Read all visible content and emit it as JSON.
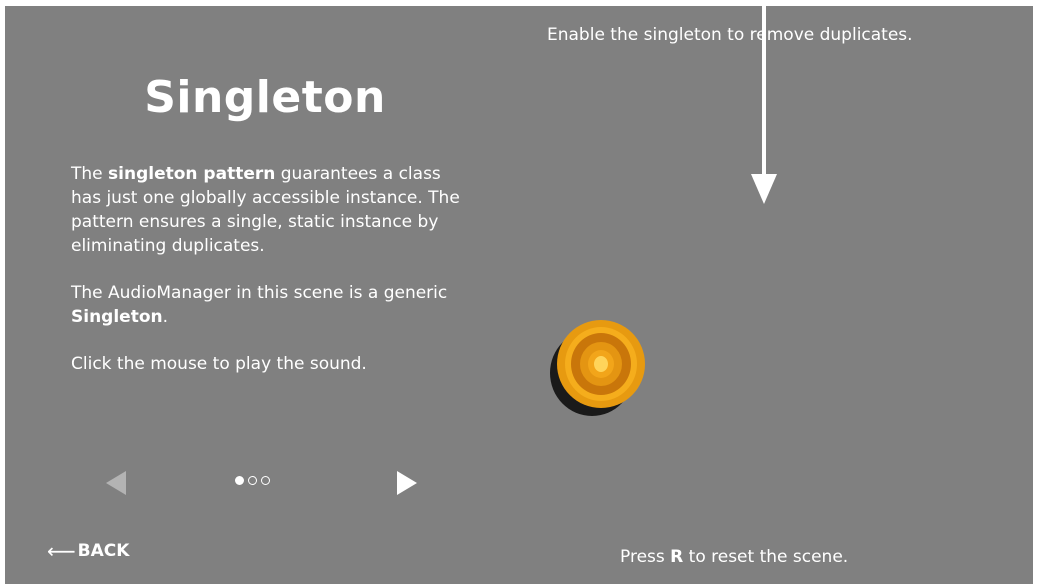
{
  "panel": {
    "title": "Singleton",
    "para1": {
      "pre": "The ",
      "bold": "singleton pattern",
      "post": " guarantees a class has just one globally accessible instance. The pattern ensures a single, static instance by eliminating duplicates."
    },
    "para2": {
      "pre": "The AudioManager in this scene is a generic ",
      "bold": "Singleton",
      "post": "."
    },
    "para3": "Click the mouse to play the sound.",
    "page_indicator": {
      "current": 1,
      "total": 3
    }
  },
  "back_label": "BACK",
  "back_arrow": "⟵",
  "hints": {
    "top": "Enable the singleton to remove duplicates.",
    "bottom_pre": "Press ",
    "bottom_key": "R",
    "bottom_post": " to reset the scene."
  },
  "colors": {
    "background": "#808080",
    "speaker_rim": "#f0a818",
    "speaker_cone": "#d4820a",
    "speaker_body": "#1a1a1a"
  },
  "icons": [
    "prev-arrow-icon",
    "next-arrow-icon",
    "down-arrow-icon",
    "speaker-icon"
  ]
}
